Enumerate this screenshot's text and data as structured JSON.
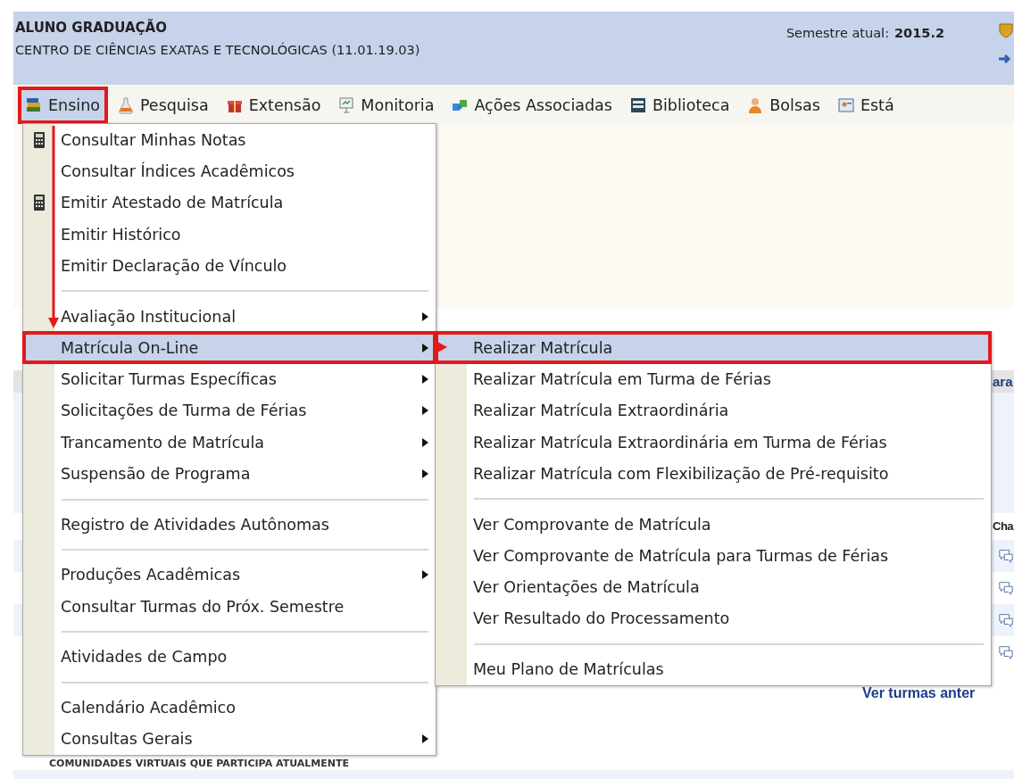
{
  "header": {
    "title": "ALUNO GRADUAÇÃO",
    "subtitle": "CENTRO DE CIÊNCIAS EXATAS E TECNOLÓGICAS (11.01.19.03)",
    "semester_label": "Semestre atual:",
    "semester_value": "2015.2"
  },
  "menubar": [
    {
      "label": "Ensino",
      "selected": true,
      "highlighted": true
    },
    {
      "label": "Pesquisa",
      "selected": false,
      "highlighted": false
    },
    {
      "label": "Extensão",
      "selected": false,
      "highlighted": false
    },
    {
      "label": "Monitoria",
      "selected": false,
      "highlighted": false
    },
    {
      "label": "Ações Associadas",
      "selected": false,
      "highlighted": false
    },
    {
      "label": "Biblioteca",
      "selected": false,
      "highlighted": false
    },
    {
      "label": "Bolsas",
      "selected": false,
      "highlighted": false
    },
    {
      "label": "Está",
      "selected": false,
      "highlighted": false
    }
  ],
  "menu": {
    "sections": [
      {
        "items": [
          {
            "label": "Consultar Minhas Notas",
            "kind": "tool",
            "has_submenu": false,
            "selected": false,
            "highlighted": false
          },
          {
            "label": "Consultar Índices Acadêmicos",
            "has_submenu": false,
            "selected": false,
            "highlighted": false
          },
          {
            "label": "Emitir Atestado de Matrícula",
            "kind": "tool",
            "has_submenu": false,
            "selected": false,
            "highlighted": false
          },
          {
            "label": "Emitir Histórico",
            "has_submenu": false,
            "selected": false,
            "highlighted": false
          },
          {
            "label": "Emitir Declaração de Vínculo",
            "has_submenu": false,
            "selected": false,
            "highlighted": false
          }
        ]
      },
      {
        "items": [
          {
            "label": "Avaliação Institucional",
            "has_submenu": true,
            "selected": false,
            "highlighted": false
          },
          {
            "label": "Matrícula On-Line",
            "has_submenu": true,
            "selected": true,
            "highlighted": true
          },
          {
            "label": "Solicitar Turmas Específicas",
            "has_submenu": true,
            "selected": false,
            "highlighted": false
          },
          {
            "label": "Solicitações de Turma de Férias",
            "has_submenu": true,
            "selected": false,
            "highlighted": false
          },
          {
            "label": "Trancamento de Matrícula",
            "has_submenu": true,
            "selected": false,
            "highlighted": false
          },
          {
            "label": "Suspensão de Programa",
            "has_submenu": true,
            "selected": false,
            "highlighted": false
          }
        ]
      },
      {
        "items": [
          {
            "label": "Registro de Atividades Autônomas",
            "has_submenu": false,
            "selected": false,
            "highlighted": false
          }
        ]
      },
      {
        "items": [
          {
            "label": "Produções Acadêmicas",
            "has_submenu": true,
            "selected": false,
            "highlighted": false
          },
          {
            "label": "Consultar Turmas do Próx. Semestre",
            "has_submenu": false,
            "selected": false,
            "highlighted": false
          }
        ]
      },
      {
        "items": [
          {
            "label": "Atividades de Campo",
            "has_submenu": false,
            "selected": false,
            "highlighted": false
          }
        ]
      },
      {
        "items": [
          {
            "label": "Calendário Acadêmico",
            "has_submenu": false,
            "selected": false,
            "highlighted": false
          },
          {
            "label": "Consultas Gerais",
            "has_submenu": true,
            "selected": false,
            "highlighted": false
          }
        ]
      }
    ]
  },
  "submenu": {
    "sections": [
      {
        "items": [
          {
            "label": "Realizar Matrícula",
            "has_submenu": false,
            "selected": true,
            "highlighted": true
          },
          {
            "label": "Realizar Matrícula em Turma de Férias",
            "has_submenu": false,
            "selected": false,
            "highlighted": false
          },
          {
            "label": "Realizar Matrícula Extraordinária",
            "has_submenu": false,
            "selected": false,
            "highlighted": false
          },
          {
            "label": "Realizar Matrícula Extraordinária em Turma de Férias",
            "has_submenu": false,
            "selected": false,
            "highlighted": false
          },
          {
            "label": "Realizar Matrícula com Flexibilização de Pré-requisito",
            "has_submenu": false,
            "selected": false,
            "highlighted": false
          }
        ]
      },
      {
        "items": [
          {
            "label": "Ver Comprovante de Matrícula",
            "has_submenu": false,
            "selected": false,
            "highlighted": false
          },
          {
            "label": "Ver Comprovante de Matrícula para Turmas de Férias",
            "has_submenu": false,
            "selected": false,
            "highlighted": false
          },
          {
            "label": "Ver Orientações de Matrícula",
            "has_submenu": false,
            "selected": false,
            "highlighted": false
          },
          {
            "label": "Ver Resultado do Processamento",
            "has_submenu": false,
            "selected": false,
            "highlighted": false
          }
        ]
      },
      {
        "items": [
          {
            "label": "Meu Plano de Matrículas",
            "has_submenu": false,
            "selected": false,
            "highlighted": false
          }
        ]
      }
    ]
  },
  "background": {
    "bar_text": "ara",
    "heading": "Cha",
    "link": "Ver turmas anter",
    "section_title": "COMUNIDADES VIRTUAIS QUE PARTICIPA ATUALMENTE"
  }
}
